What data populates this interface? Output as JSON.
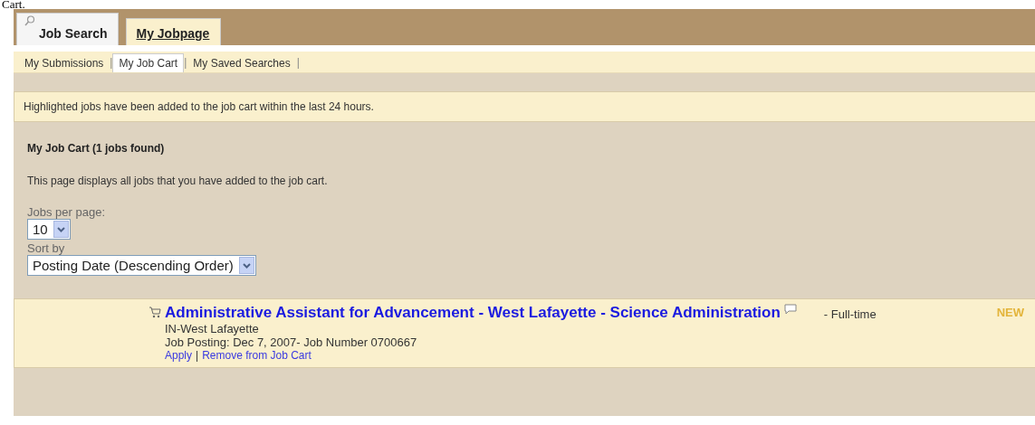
{
  "page_heading": "Cart.",
  "tabs": [
    {
      "label": "Job Search",
      "selected": false
    },
    {
      "label": "My Jobpage",
      "selected": true
    }
  ],
  "subtabs": [
    {
      "label": "My Submissions",
      "selected": false
    },
    {
      "label": "My Job Cart",
      "selected": true
    },
    {
      "label": "My Saved Searches",
      "selected": false
    }
  ],
  "separator": "|",
  "notice": "Highlighted jobs have been added to the job cart within the last 24 hours.",
  "title": "My Job Cart (1 jobs found)",
  "description": "This page displays all jobs that you have added to the job cart.",
  "jobs_per_page": {
    "label": "Jobs per page:",
    "value": "10"
  },
  "sort_by": {
    "label": "Sort by",
    "value": "Posting Date (Descending Order)"
  },
  "jobs": [
    {
      "title": "Administrative Assistant for Advancement - West Lafayette - Science Administration",
      "type": "- Full-time",
      "badge": "NEW",
      "location": "IN-West Lafayette",
      "posting": "Job Posting: Dec 7, 2007- Job Number 0700667",
      "actions": [
        "Apply",
        "Remove from Job Cart"
      ],
      "highlighted": true
    }
  ]
}
